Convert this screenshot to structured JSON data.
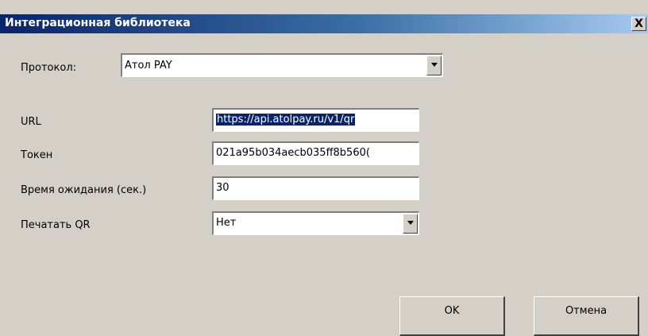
{
  "window": {
    "title": "Интеграционная библиотека",
    "close_label": "X"
  },
  "protocol": {
    "label": "Протокол:",
    "value": "Атол PAY"
  },
  "fields": {
    "url": {
      "label": "URL",
      "value": "https://api.atolpay.ru/v1/qr"
    },
    "token": {
      "label": "Токен",
      "value": "021a95b034aecb035ff8b560( "
    },
    "timeout": {
      "label": "Время ожидания (сек.)",
      "value": "30"
    },
    "print_qr": {
      "label": "Печатать QR",
      "value": "Нет"
    }
  },
  "buttons": {
    "ok": "OK",
    "cancel": "Отмена"
  },
  "colors": {
    "titlebar_start": "#0a246a",
    "titlebar_end": "#a6caf0",
    "face": "#d4d0c8",
    "selection": "#0a246a"
  }
}
